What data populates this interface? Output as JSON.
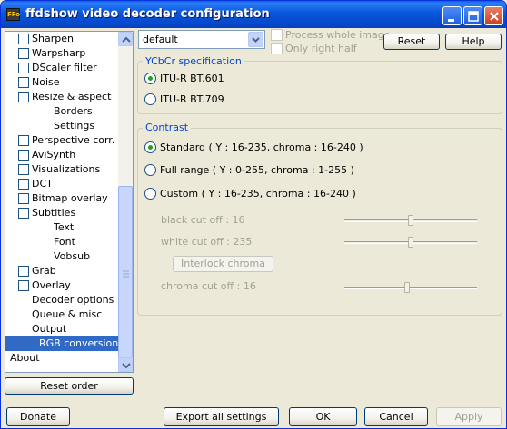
{
  "window": {
    "title": "ffdshow video decoder configuration",
    "icon": "ffdshow-app-icon"
  },
  "tree": {
    "items": [
      {
        "label": "Sharpen",
        "checkbox": true
      },
      {
        "label": "Warpsharp",
        "checkbox": true
      },
      {
        "label": "DScaler filter",
        "checkbox": true
      },
      {
        "label": "Noise",
        "checkbox": true
      },
      {
        "label": "Resize & aspect",
        "checkbox": true
      },
      {
        "label": "Borders",
        "checkbox": false
      },
      {
        "label": "Settings",
        "checkbox": false
      },
      {
        "label": "Perspective corr.",
        "checkbox": true
      },
      {
        "label": "AviSynth",
        "checkbox": true
      },
      {
        "label": "Visualizations",
        "checkbox": true
      },
      {
        "label": "DCT",
        "checkbox": true
      },
      {
        "label": "Bitmap overlay",
        "checkbox": true
      },
      {
        "label": "Subtitles",
        "checkbox": true
      },
      {
        "label": "Text",
        "checkbox": false
      },
      {
        "label": "Font",
        "checkbox": false
      },
      {
        "label": "Vobsub",
        "checkbox": false
      },
      {
        "label": "Grab",
        "checkbox": true
      },
      {
        "label": "Overlay",
        "checkbox": true
      },
      {
        "label": "Decoder options",
        "checkbox": false
      },
      {
        "label": "Queue & misc",
        "checkbox": false
      },
      {
        "label": "Output",
        "checkbox": false
      },
      {
        "label": "RGB conversion",
        "checkbox": false,
        "selected": true
      },
      {
        "label": "About",
        "checkbox": false
      }
    ]
  },
  "reset_order_label": "Reset order",
  "preset": {
    "value": "default"
  },
  "process_whole_image": "Process whole image",
  "only_right_half": "Only right half",
  "reset_label": "Reset",
  "help_label": "Help",
  "ycbcr": {
    "title": "YCbCr specification",
    "options": [
      "ITU-R BT.601",
      "ITU-R BT.709"
    ],
    "selected": 0
  },
  "contrast": {
    "title": "Contrast",
    "options": [
      "Standard ( Y : 16-235, chroma : 16-240 )",
      "Full range ( Y : 0-255, chroma : 1-255 )",
      "Custom ( Y : 16-235, chroma : 16-240 )"
    ],
    "selected": 0,
    "black_cutoff": "black cut off : 16",
    "white_cutoff": "white cut off : 235",
    "interlock_label": "Interlock chroma",
    "chroma_cutoff": "chroma cut off : 16",
    "sliders": {
      "black": 16,
      "white": 235,
      "chroma": 16,
      "min": 0,
      "max": 32
    }
  },
  "footer": {
    "donate": "Donate",
    "export": "Export all settings",
    "ok": "OK",
    "cancel": "Cancel",
    "apply": "Apply"
  }
}
